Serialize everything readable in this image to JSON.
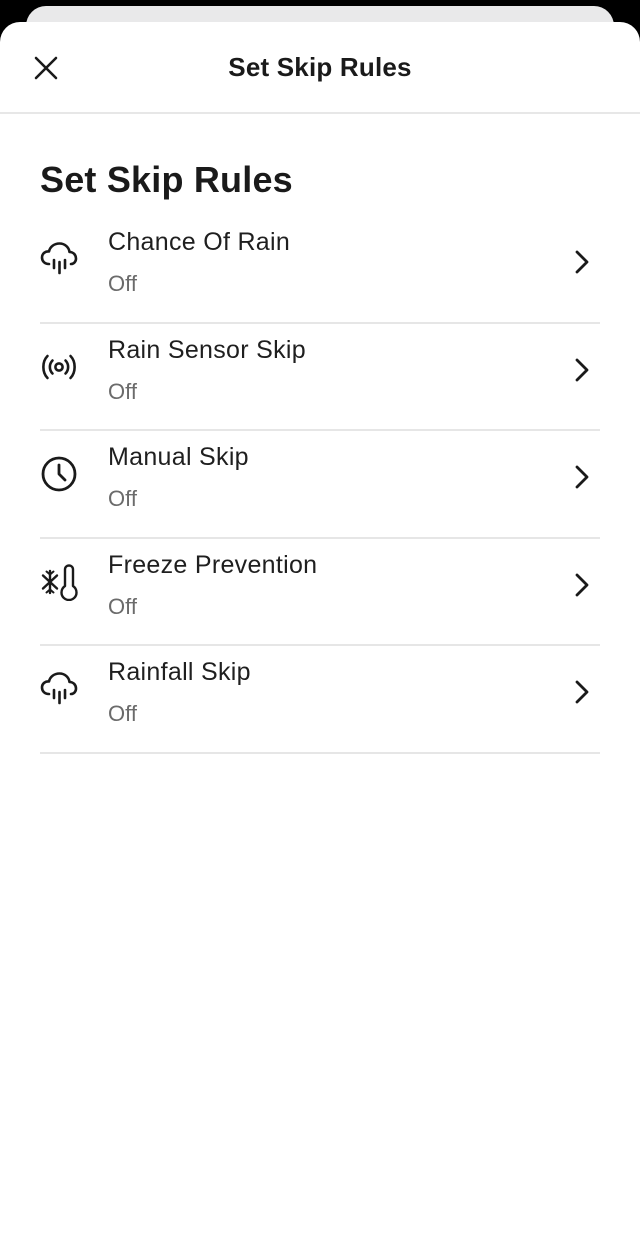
{
  "header": {
    "title": "Set Skip Rules"
  },
  "page": {
    "heading": "Set Skip Rules"
  },
  "rules": [
    {
      "label": "Chance Of Rain",
      "status": "Off",
      "icon": "cloud-rain-icon"
    },
    {
      "label": "Rain Sensor Skip",
      "status": "Off",
      "icon": "broadcast-sensor-icon"
    },
    {
      "label": "Manual Skip",
      "status": "Off",
      "icon": "clock-icon"
    },
    {
      "label": "Freeze Prevention",
      "status": "Off",
      "icon": "snowflake-thermometer-icon"
    },
    {
      "label": "Rainfall Skip",
      "status": "Off",
      "icon": "cloud-rain-icon"
    }
  ],
  "colors": {
    "text": "#1a1a1a",
    "secondary_text": "#6b6b6b",
    "divider": "#e6e6e6",
    "background": "#ffffff"
  }
}
